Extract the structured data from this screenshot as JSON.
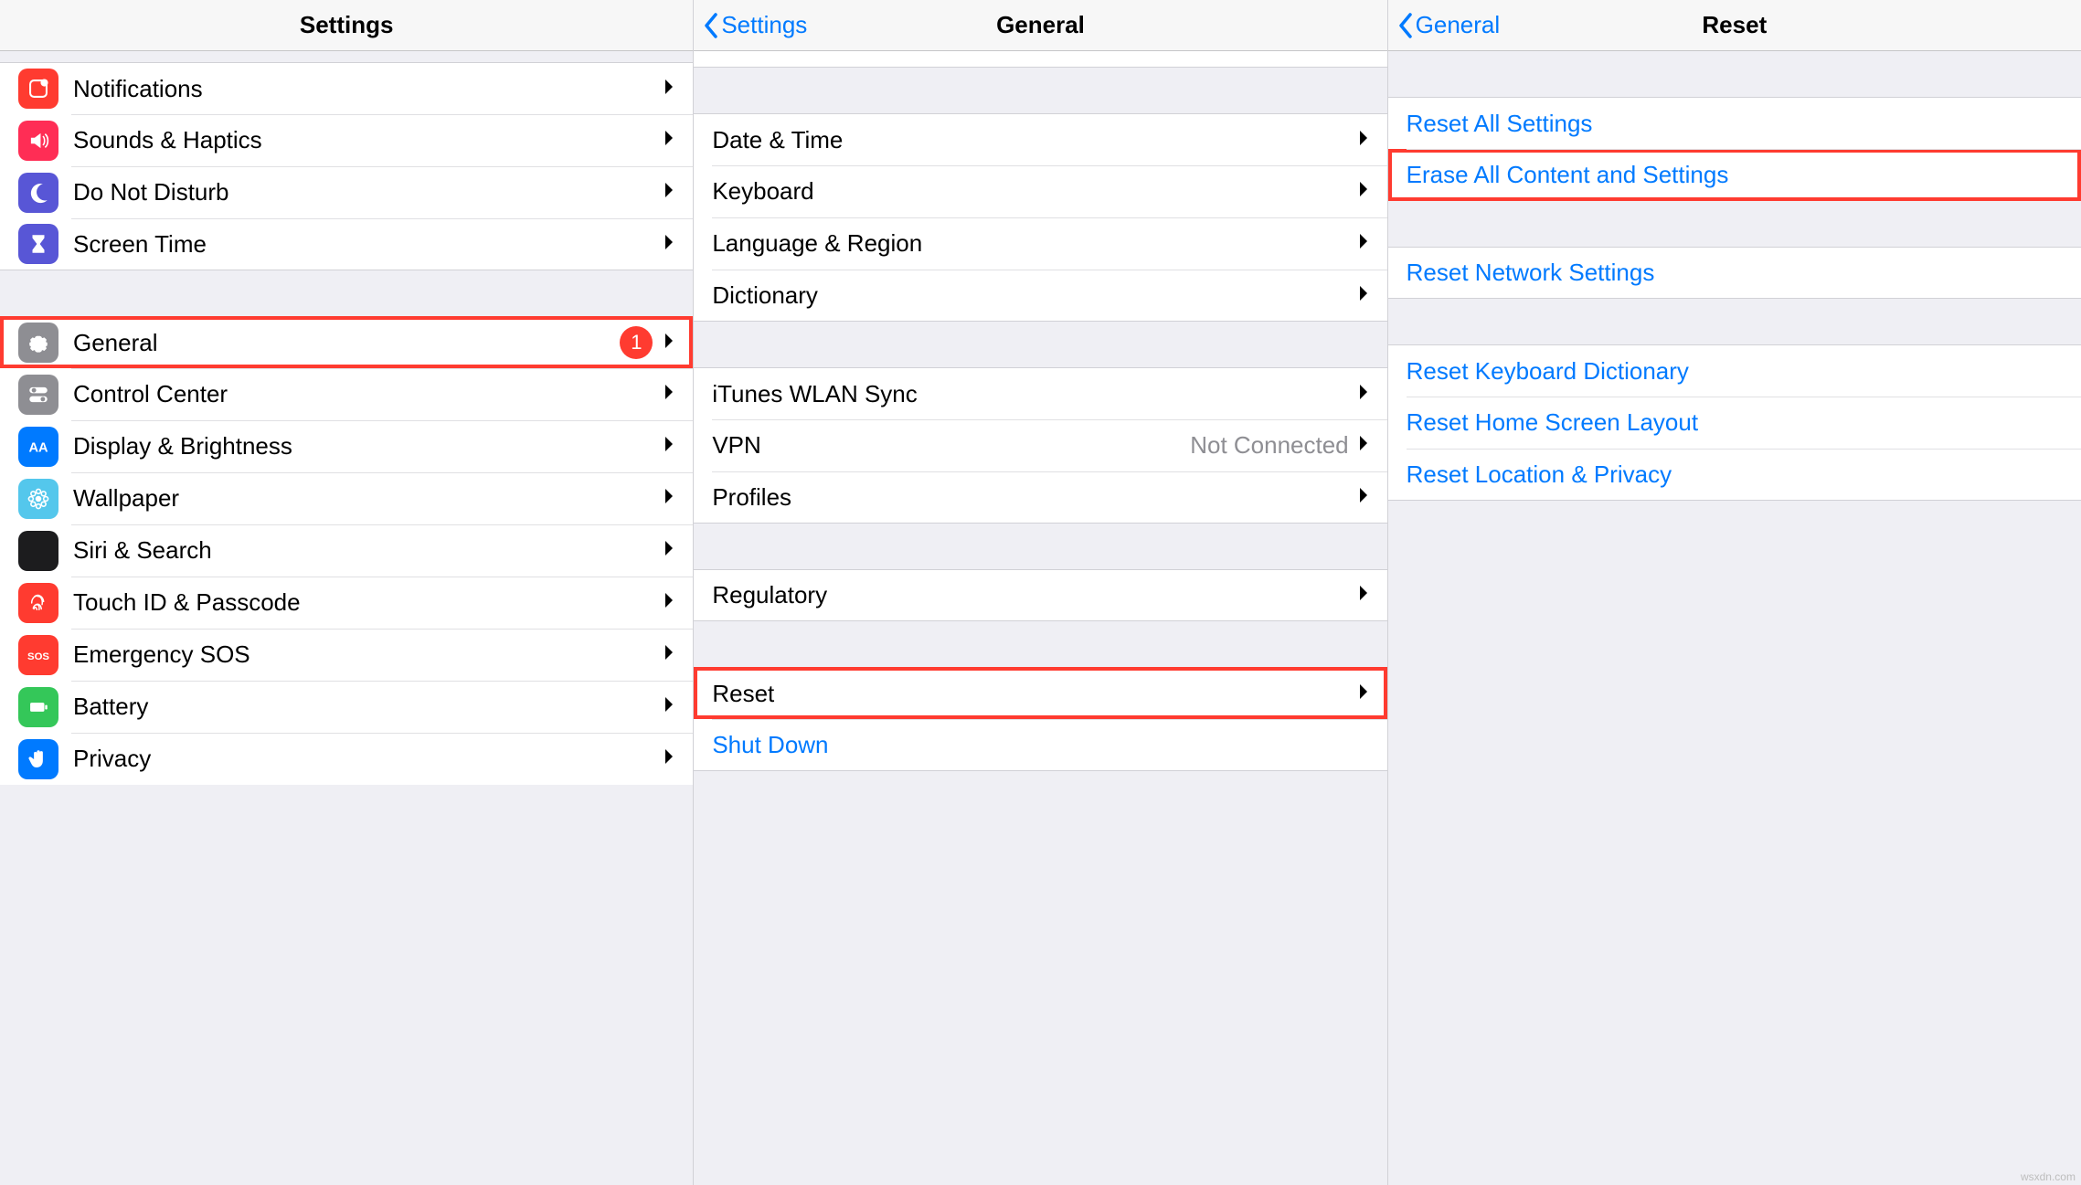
{
  "panel1": {
    "title": "Settings",
    "items": [
      {
        "label": "Notifications",
        "color": "#ff3b30"
      },
      {
        "label": "Sounds & Haptics",
        "color": "#ff2d55"
      },
      {
        "label": "Do Not Disturb",
        "color": "#5856d6"
      },
      {
        "label": "Screen Time",
        "color": "#5856d6"
      }
    ],
    "items2": [
      {
        "label": "General",
        "color": "#8e8e93",
        "badge": "1"
      },
      {
        "label": "Control Center",
        "color": "#8e8e93"
      },
      {
        "label": "Display & Brightness",
        "color": "#007aff"
      },
      {
        "label": "Wallpaper",
        "color": "#54c7ec"
      },
      {
        "label": "Siri & Search",
        "color": "#1c1c1e"
      },
      {
        "label": "Touch ID & Passcode",
        "color": "#ff3b30"
      },
      {
        "label": "Emergency SOS",
        "color": "#ff3b30"
      },
      {
        "label": "Battery",
        "color": "#34c759"
      },
      {
        "label": "Privacy",
        "color": "#007aff"
      }
    ]
  },
  "panel2": {
    "back": "Settings",
    "title": "General",
    "groupA": [
      {
        "label": "Date & Time"
      },
      {
        "label": "Keyboard"
      },
      {
        "label": "Language & Region"
      },
      {
        "label": "Dictionary"
      }
    ],
    "groupB": [
      {
        "label": "iTunes WLAN Sync"
      },
      {
        "label": "VPN",
        "value": "Not Connected"
      },
      {
        "label": "Profiles"
      }
    ],
    "groupC": [
      {
        "label": "Regulatory"
      }
    ],
    "groupD": [
      {
        "label": "Reset"
      }
    ],
    "shutdown": "Shut Down"
  },
  "panel3": {
    "back": "General",
    "title": "Reset",
    "groupA": [
      "Reset All Settings",
      "Erase All Content and Settings"
    ],
    "groupB": [
      "Reset Network Settings"
    ],
    "groupC": [
      "Reset Keyboard Dictionary",
      "Reset Home Screen Layout",
      "Reset Location & Privacy"
    ]
  },
  "watermark": "wsxdn.com"
}
